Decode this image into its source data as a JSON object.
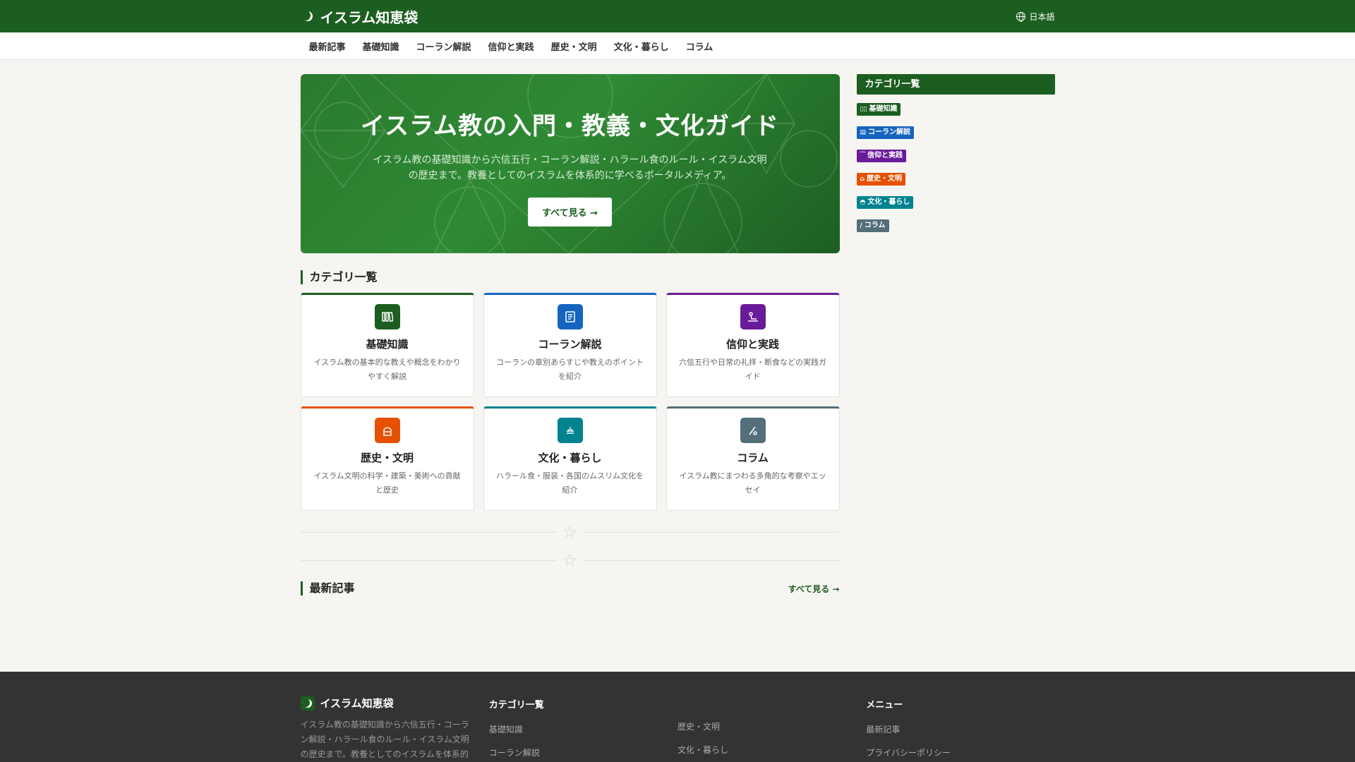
{
  "header": {
    "site_title": "イスラム知恵袋",
    "language": "日本語"
  },
  "nav": {
    "items": [
      "最新記事",
      "基礎知識",
      "コーラン解説",
      "信仰と実践",
      "歴史・文明",
      "文化・暮らし",
      "コラム"
    ]
  },
  "hero": {
    "title": "イスラム教の入門・教義・文化ガイド",
    "description": "イスラム教の基礎知識から六信五行・コーラン解説・ハラール食のルール・イスラム文明の歴史まで。教養としてのイスラムを体系的に学べるポータルメディア。",
    "button": "すべて見る →"
  },
  "categories_section": {
    "title": "カテゴリ一覧",
    "cards": [
      {
        "title": "基礎知識",
        "desc": "イスラム教の基本的な教えや概念をわかりやすく解説",
        "color": "#1c5e20",
        "icon": "book-icon"
      },
      {
        "title": "コーラン解説",
        "desc": "コーランの章別あらすじや教えのポイントを紹介",
        "color": "#1565c0",
        "icon": "document-icon"
      },
      {
        "title": "信仰と実践",
        "desc": "六信五行や日常の礼拝・断食などの実践ガイド",
        "color": "#6a1b9a",
        "icon": "prayer-icon"
      },
      {
        "title": "歴史・文明",
        "desc": "イスラム文明の科学・建築・美術への貢献と歴史",
        "color": "#e65100",
        "icon": "mosque-icon"
      },
      {
        "title": "文化・暮らし",
        "desc": "ハラール食・服装・各国のムスリム文化を紹介",
        "color": "#00838f",
        "icon": "food-icon"
      },
      {
        "title": "コラム",
        "desc": "イスラム教にまつわる多角的な考察やエッセイ",
        "color": "#546e7a",
        "icon": "pen-icon"
      }
    ]
  },
  "latest_section": {
    "title": "最新記事",
    "link": "すべて見る →"
  },
  "sidebar": {
    "title": "カテゴリ一覧",
    "tags": [
      {
        "label": "基礎知識",
        "color": "#1c5e20",
        "icon": "book-icon"
      },
      {
        "label": "コーラン解説",
        "color": "#1565c0",
        "icon": "document-icon"
      },
      {
        "label": "信仰と実践",
        "color": "#6a1b9a",
        "icon": "prayer-icon"
      },
      {
        "label": "歴史・文明",
        "color": "#e65100",
        "icon": "mosque-icon"
      },
      {
        "label": "文化・暮らし",
        "color": "#00838f",
        "icon": "food-icon"
      },
      {
        "label": "コラム",
        "color": "#546e7a",
        "icon": "pen-icon"
      }
    ]
  },
  "footer": {
    "site_title": "イスラム知恵袋",
    "description": "イスラム教の基礎知識から六信五行・コーラン解説・ハラール食のルール・イスラム文明の歴史まで。教養としてのイスラムを体系的",
    "categories_title": "カテゴリ一覧",
    "categories_col1": [
      "基礎知識",
      "コーラン解説"
    ],
    "categories_col2": [
      "歴史・文明",
      "文化・暮らし"
    ],
    "menu_title": "メニュー",
    "menu": [
      "最新記事",
      "プライバシーポリシー"
    ]
  }
}
